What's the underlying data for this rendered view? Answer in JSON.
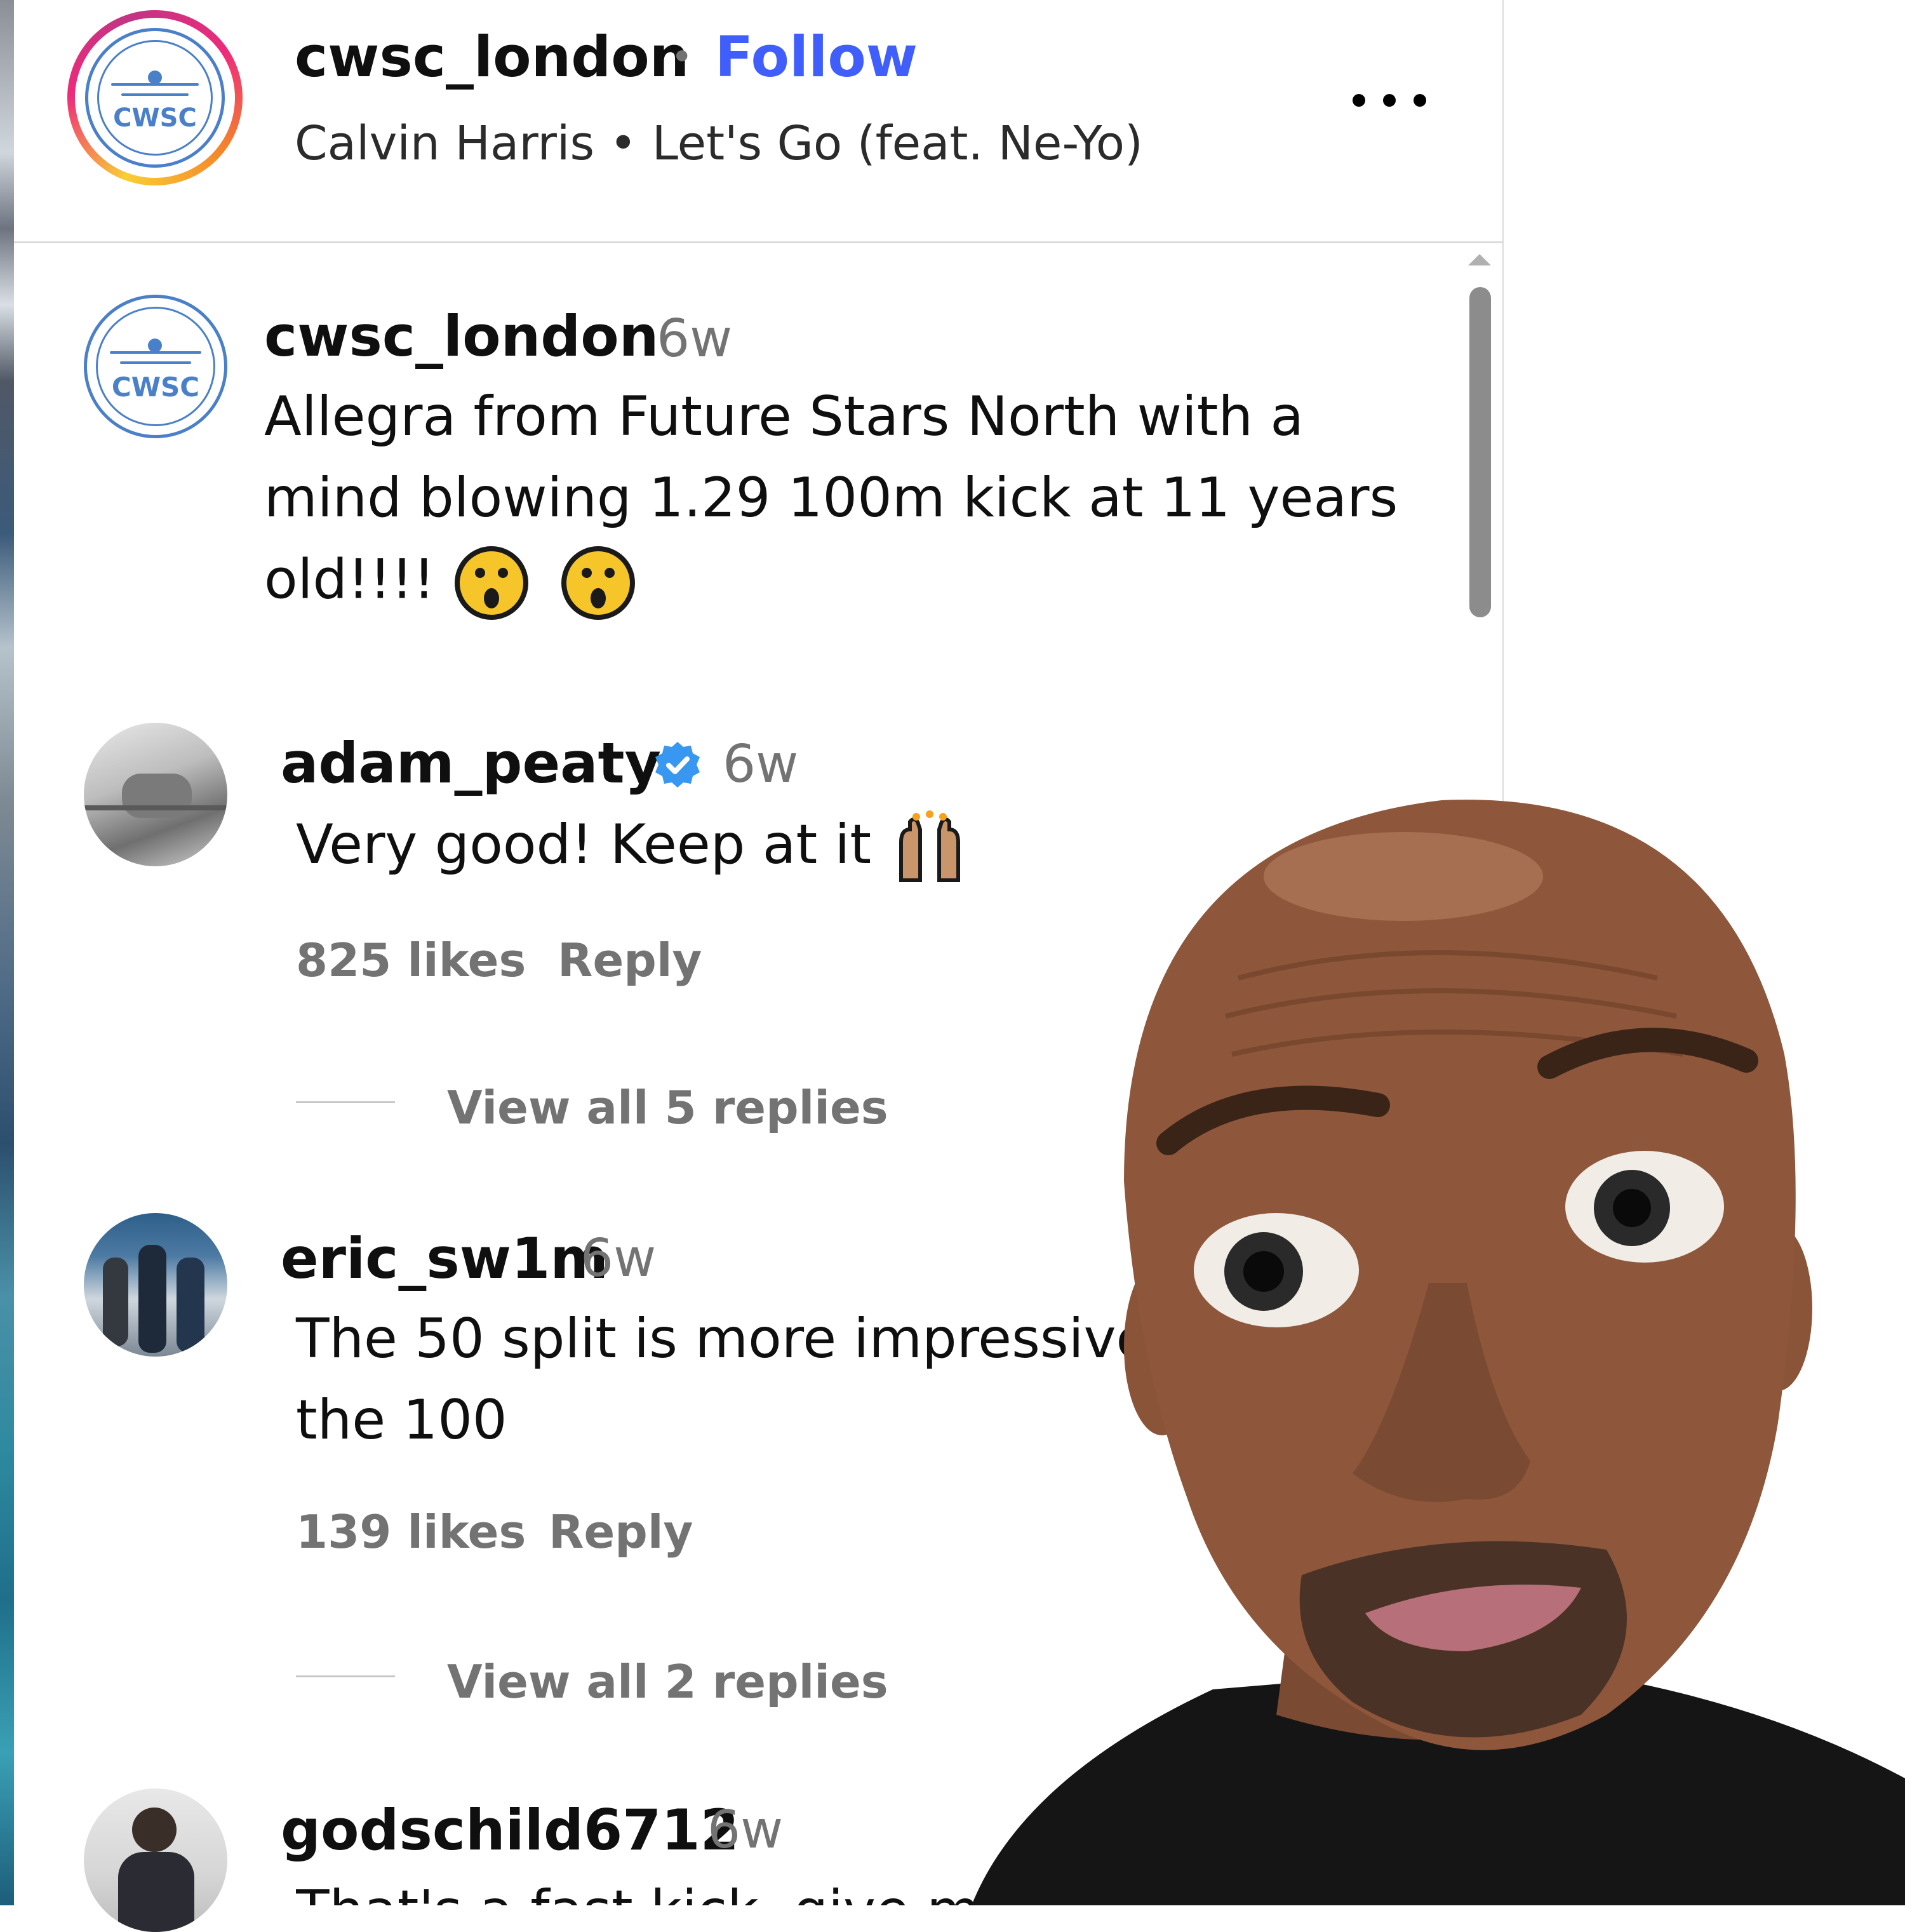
{
  "header": {
    "username": "cwsc_london",
    "separator": "•",
    "follow_label": "Follow",
    "audio": "Calvin Harris • Let's Go (feat. Ne-Yo)",
    "logo_text": "CWSC"
  },
  "caption": {
    "username": "cwsc_london",
    "time": "6w",
    "line1": "Allegra from Future Stars North with a",
    "line2": "mind blowing 1.29 100m kick at 11 years",
    "line3": "old!!!!"
  },
  "comments": [
    {
      "username": "adam_peaty",
      "verified": true,
      "time": "6w",
      "text": "Very good! Keep at it",
      "likes": "825 likes",
      "reply_label": "Reply",
      "view_replies": "View all 5 replies"
    },
    {
      "username": "eric_sw1m",
      "time": "6w",
      "line1": "The 50 split is more impressive",
      "line2": "the 100",
      "likes": "139 likes",
      "reply_label": "Reply",
      "view_replies": "View all 2 replies"
    },
    {
      "username": "godschild6712",
      "time": "6w",
      "text": "That's a fast kick, give me"
    }
  ],
  "icons": {
    "more": "more-options-icon",
    "verified": "verified-badge-icon",
    "emoji_caption": "astonished-face-emoji",
    "emoji_comment": "raising-hands-emoji"
  },
  "colors": {
    "follow": "#3f5efb",
    "muted": "#737373",
    "verified": "#3897f0",
    "logo": "#4a7fc9"
  }
}
